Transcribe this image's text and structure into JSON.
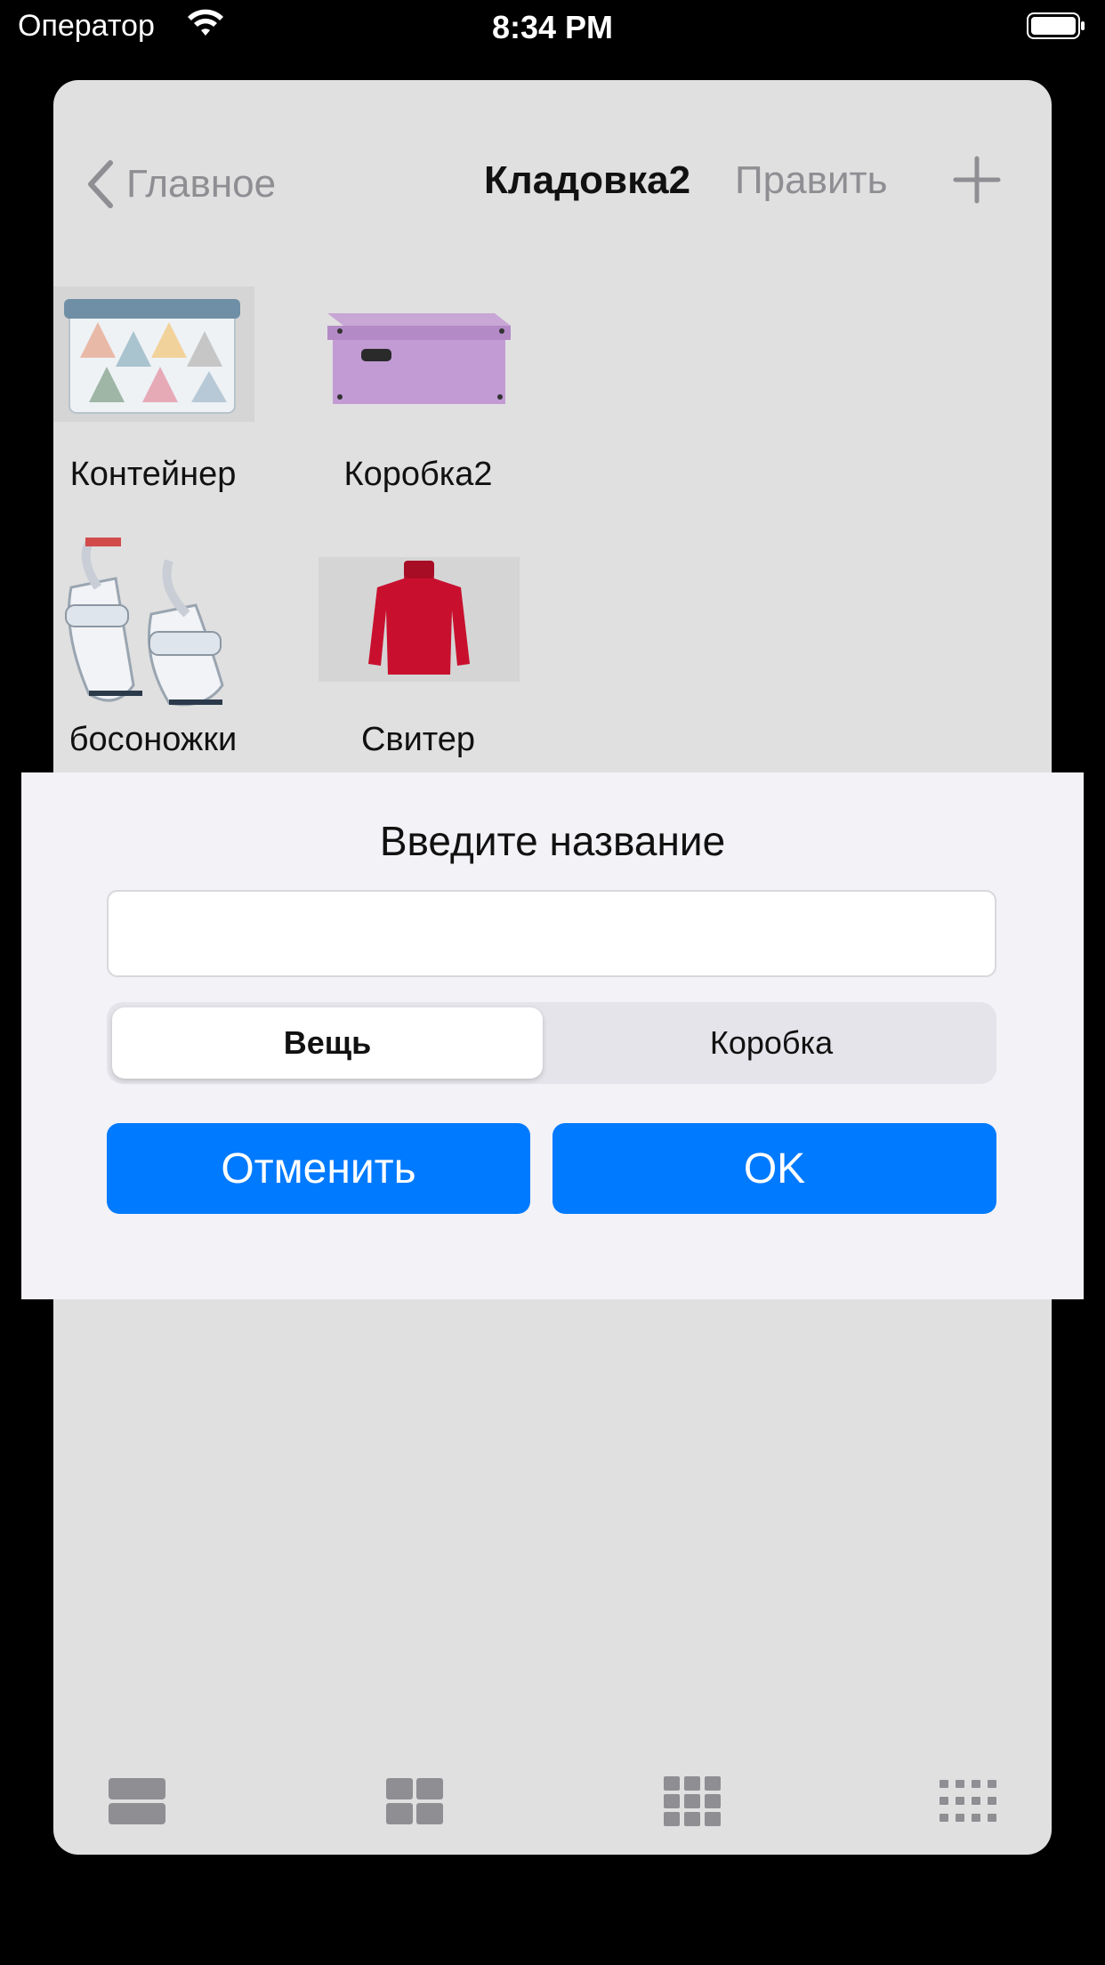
{
  "status_bar": {
    "carrier": "Оператор",
    "time": "8:34 PM"
  },
  "nav": {
    "back_label": "Главное",
    "title": "Кладовка2",
    "edit_label": "Править"
  },
  "items": [
    {
      "label": "Контейнер",
      "icon": "container-image"
    },
    {
      "label": "Коробка2",
      "icon": "box-image"
    },
    {
      "label": "босоножки",
      "icon": "sandals-image"
    },
    {
      "label": "Свитер",
      "icon": "sweater-image"
    }
  ],
  "dialog": {
    "title": "Введите название",
    "input_value": "",
    "segments": [
      "Вещь",
      "Коробка"
    ],
    "selected_segment": "Вещь",
    "cancel_label": "Отменить",
    "ok_label": "OK"
  },
  "toolbar": [
    "layout-1-column-icon",
    "layout-2-column-icon",
    "layout-3-column-icon",
    "layout-4-column-icon"
  ],
  "colors": {
    "accent": "#007aff",
    "card_bg": "#e0e0e0",
    "dialog_bg": "#f2f2f7"
  }
}
